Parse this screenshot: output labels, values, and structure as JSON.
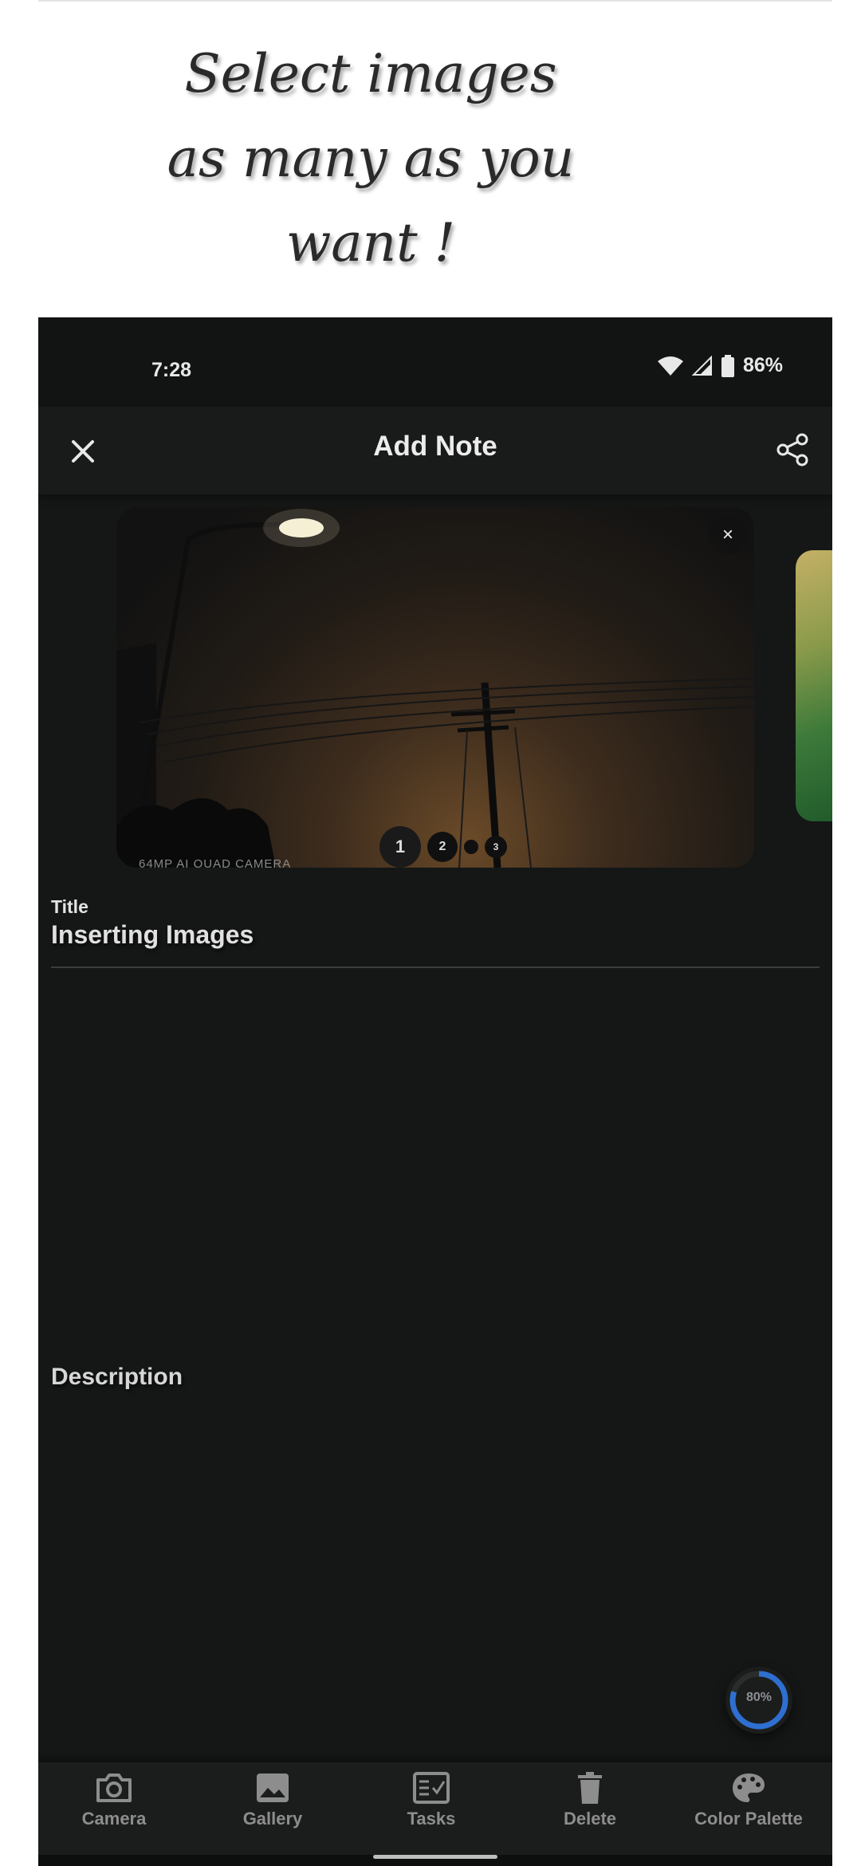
{
  "headline": [
    "Select images",
    "as many as you",
    "want !"
  ],
  "status_bar": {
    "time": "7:28",
    "battery": "86%"
  },
  "app_bar": {
    "title": "Add Note",
    "close_icon": "close-icon",
    "share_icon": "share-icon"
  },
  "carousel": {
    "image_caption": "64MP AI QUAD CAMERA",
    "remove_label": "×",
    "pages": [
      "1",
      "2",
      "",
      "3"
    ]
  },
  "note": {
    "title_label": "Title",
    "title_value": "Inserting Images",
    "description_label": "Description"
  },
  "progress": {
    "label": "80%",
    "value": 0.8,
    "color": "#2e6fd1"
  },
  "bottom_nav": [
    {
      "label": "Camera",
      "icon": "camera-icon"
    },
    {
      "label": "Gallery",
      "icon": "image-icon"
    },
    {
      "label": "Tasks",
      "icon": "tasks-icon"
    },
    {
      "label": "Delete",
      "icon": "trash-icon"
    },
    {
      "label": "Color Palette",
      "icon": "palette-icon"
    }
  ]
}
